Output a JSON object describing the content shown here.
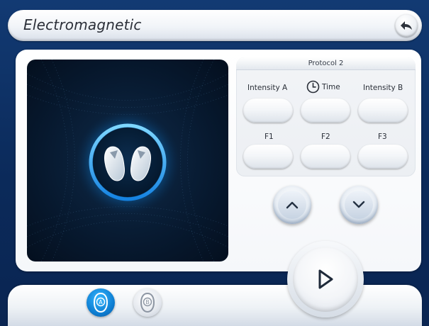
{
  "header": {
    "title": "Electromagnetic",
    "back_icon": "back-arrow-icon"
  },
  "protocol": {
    "title": "Protocol 2",
    "params": [
      {
        "label": "Intensity A",
        "value": ""
      },
      {
        "label": "Time",
        "value": "",
        "icon": "clock-icon"
      },
      {
        "label": "Intensity B",
        "value": ""
      },
      {
        "label": "F1",
        "value": ""
      },
      {
        "label": "F2",
        "value": ""
      },
      {
        "label": "F3",
        "value": ""
      }
    ]
  },
  "controls": {
    "up_icon": "chevron-up-icon",
    "down_icon": "chevron-down-icon",
    "play_icon": "play-icon"
  },
  "channels": [
    {
      "label": "A",
      "state": "active"
    },
    {
      "label": "B",
      "state": "inactive"
    }
  ],
  "colors": {
    "background": "#0d2f63",
    "accent": "#0e7fd3",
    "glow": "#1aa8ff"
  }
}
